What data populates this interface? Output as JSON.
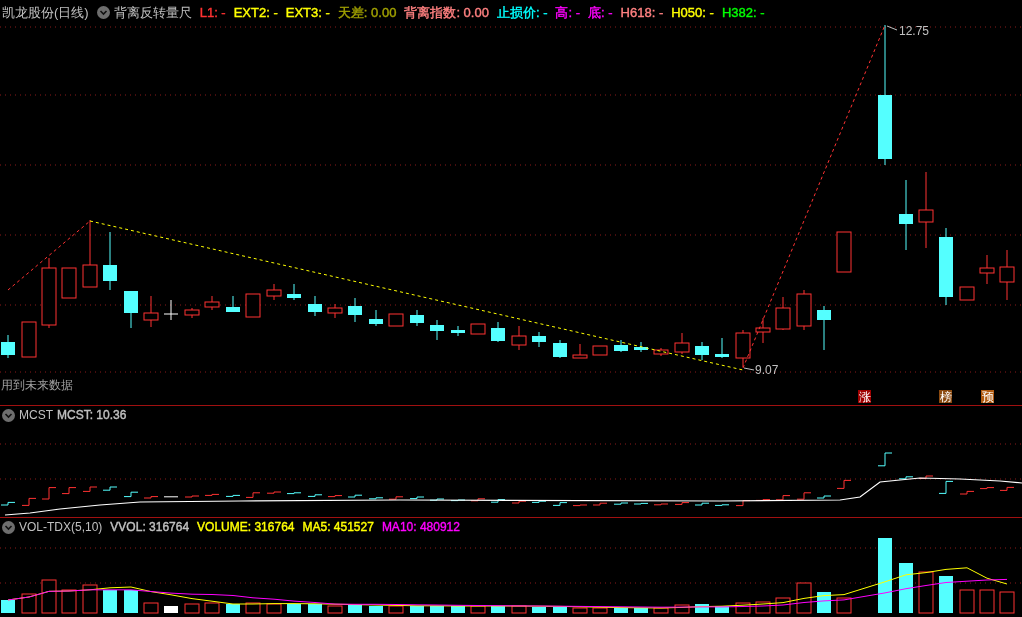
{
  "main_panel": {
    "title": "凯龙股份(日线)",
    "indicator": "背离反转量尺",
    "legend": [
      {
        "text": "L1: -",
        "color": "#ff3232"
      },
      {
        "text": "EXT2: -",
        "color": "#ffff00"
      },
      {
        "text": "EXT3: -",
        "color": "#ffff00"
      },
      {
        "text": "天差: 0.00",
        "color": "#a0a000"
      },
      {
        "text": "背离指数: 0.00",
        "color": "#ff8080"
      },
      {
        "text": "止损价: -",
        "color": "#00ffff"
      },
      {
        "text": "高: -",
        "color": "#ff00ff"
      },
      {
        "text": "底: -",
        "color": "#ff00ff"
      },
      {
        "text": "H618: -",
        "color": "#ff8080"
      },
      {
        "text": "H050: -",
        "color": "#ffff00"
      },
      {
        "text": "H382: -",
        "color": "#00ff00"
      }
    ],
    "high_label": "12.75",
    "low_label": "9.07",
    "note": "用到未来数据",
    "markers": [
      {
        "text": "涨",
        "color": "#a00000"
      },
      {
        "text": "榜",
        "color": "#8b4a10"
      },
      {
        "text": "预",
        "color": "#b05a10"
      }
    ]
  },
  "mcst_panel": {
    "title": "MCST",
    "legend": [
      {
        "text": "MCST: 10.36",
        "color": "#c0c0c0"
      }
    ]
  },
  "vol_panel": {
    "title": "VOL-TDX(5,10)",
    "legend": [
      {
        "text": "VVOL: 316764",
        "color": "#c0c0c0"
      },
      {
        "text": "VOLUME: 316764",
        "color": "#ffff00"
      },
      {
        "text": "MA5: 451527",
        "color": "#ffff00"
      },
      {
        "text": "MA10: 480912",
        "color": "#ff00ff"
      }
    ]
  }
}
